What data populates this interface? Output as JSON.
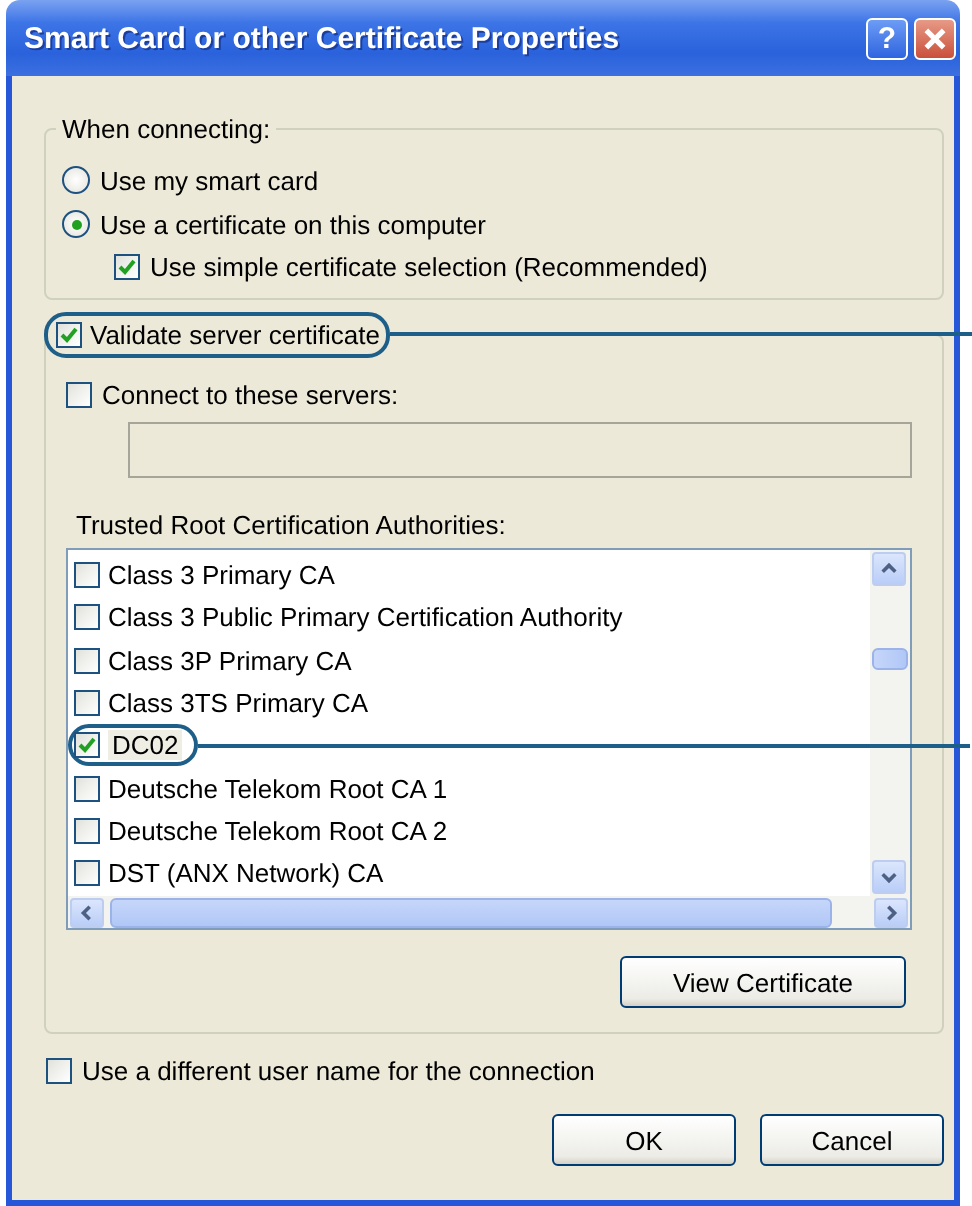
{
  "window": {
    "title": "Smart Card or other Certificate Properties",
    "help": "?"
  },
  "when_connecting": {
    "label": "When connecting:",
    "options": [
      {
        "label": "Use my smart card",
        "selected": false
      },
      {
        "label": "Use a certificate on this computer",
        "selected": true
      }
    ],
    "simple_selection": {
      "label": "Use simple certificate selection (Recommended)",
      "checked": true
    }
  },
  "validate": {
    "label": "Validate server certificate",
    "checked": true,
    "callout": true
  },
  "connect_servers": {
    "label": "Connect to these servers:",
    "checked": false
  },
  "trusted_root": {
    "label": "Trusted Root Certification Authorities:",
    "items": [
      {
        "label": "Class 3 Primary CA",
        "checked": false,
        "callout": false
      },
      {
        "label": "Class 3 Public Primary Certification Authority",
        "checked": false,
        "callout": false
      },
      {
        "label": "Class 3P Primary CA",
        "checked": false,
        "callout": false
      },
      {
        "label": "Class 3TS Primary CA",
        "checked": false,
        "callout": false
      },
      {
        "label": "DC02",
        "checked": true,
        "callout": true
      },
      {
        "label": "Deutsche Telekom Root CA 1",
        "checked": false,
        "callout": false
      },
      {
        "label": "Deutsche Telekom Root CA 2",
        "checked": false,
        "callout": false
      },
      {
        "label": "DST (ANX Network) CA",
        "checked": false,
        "callout": false
      }
    ]
  },
  "view_certificate": "View Certificate",
  "different_user": {
    "label": "Use a different user name for the connection",
    "checked": false
  },
  "buttons": [
    "OK",
    "Cancel"
  ]
}
